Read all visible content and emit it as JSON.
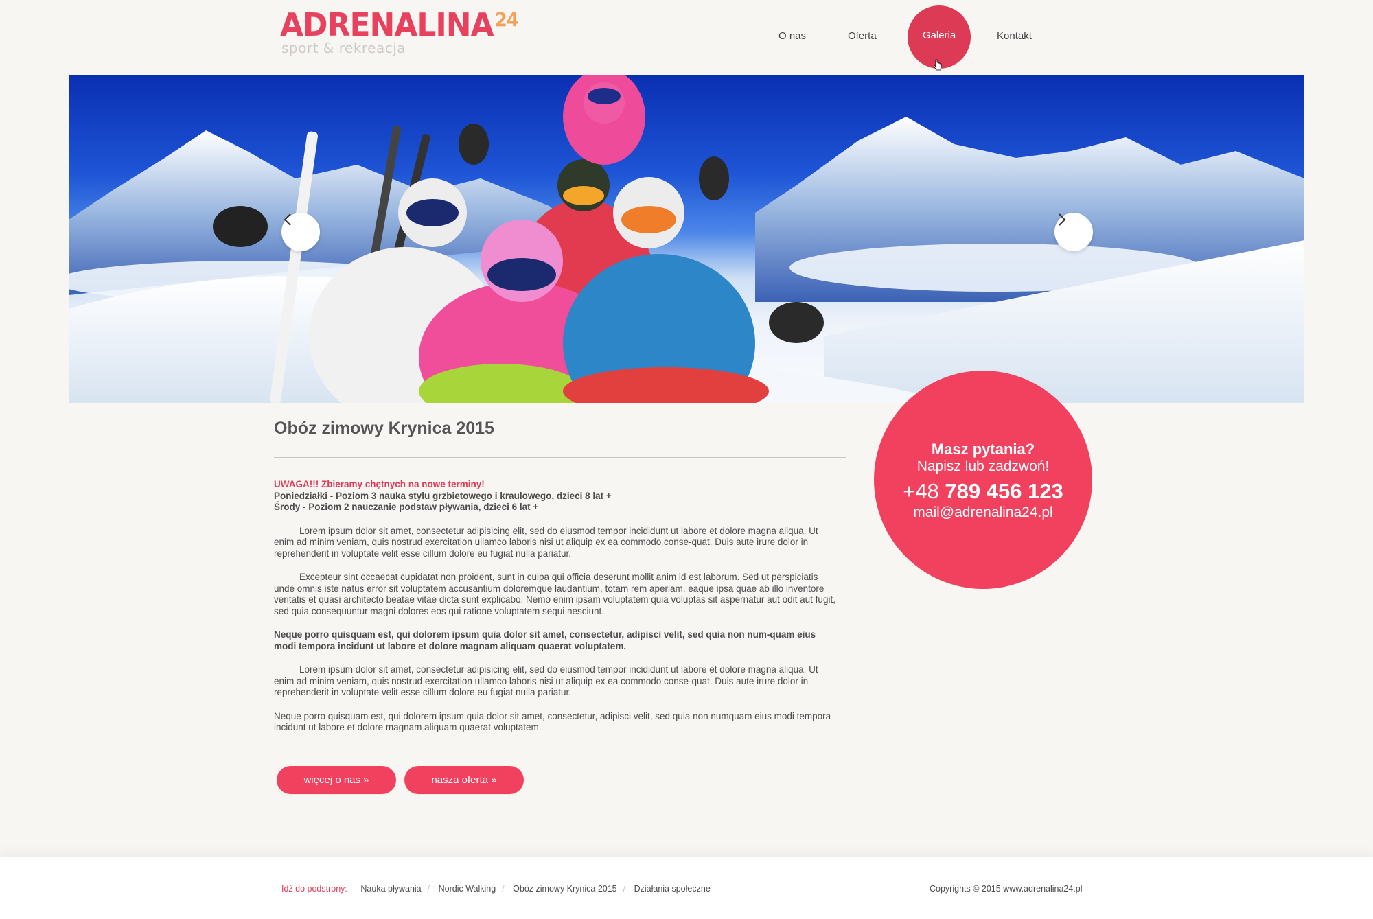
{
  "logo": {
    "main": "ADRENALINA",
    "num": "24",
    "sub": "sport & rekreacja"
  },
  "nav": {
    "items": [
      "O nas",
      "Oferta",
      "Galeria",
      "Kontakt"
    ],
    "active": "Galeria"
  },
  "hero": {
    "prev_icon": "chevron-left-icon",
    "next_icon": "chevron-right-icon"
  },
  "contact": {
    "question": "Masz pytania?",
    "subline": "Napisz lub zadzwoń!",
    "phone_prefix": "+48",
    "phone_number": "789 456 123",
    "email": "mail@adrenalina24.pl"
  },
  "article": {
    "title": "Obóz zimowy Krynica 2015",
    "warning": "UWAGA!!! Zbieramy chętnych na nowe terminy!",
    "line1": "Poniedziałki - Poziom 3 nauka stylu grzbietowego i kraulowego, dzieci 8 lat +",
    "line2": "Środy - Poziom 2 nauczanie podstaw pływania, dzieci 6 lat +",
    "p1": "Lorem ipsum dolor sit amet, consectetur adipisicing elit, sed do eiusmod tempor incididunt ut labore et dolore magna aliqua. Ut enim ad minim veniam, quis nostrud exercitation ullamco laboris nisi ut aliquip ex ea commodo conse-quat. Duis aute irure dolor in reprehenderit in voluptate velit esse cillum dolore eu fugiat nulla pariatur.",
    "p2": "Excepteur sint occaecat cupidatat non proident, sunt in culpa qui officia deserunt mollit anim id est laborum. Sed ut perspiciatis unde omnis iste natus error sit voluptatem accusantium doloremque laudantium, totam rem aperiam, eaque ipsa quae ab illo inventore veritatis et quasi architecto beatae vitae dicta sunt explicabo. Nemo enim ipsam voluptatem quia voluptas sit aspernatur aut odit aut fugit, sed quia consequuntur magni dolores eos qui ratione voluptatem sequi nesciunt.",
    "p3": "Neque porro quisquam est, qui dolorem ipsum quia dolor sit amet, consectetur, adipisci velit, sed quia non num-quam eius modi tempora incidunt ut labore et dolore magnam aliquam quaerat voluptatem.",
    "p4": "Lorem ipsum dolor sit amet, consectetur adipisicing elit, sed do eiusmod tempor incididunt ut labore et dolore magna aliqua. Ut enim ad minim veniam, quis nostrud exercitation ullamco laboris nisi ut aliquip ex ea commodo conse-quat. Duis aute irure dolor in reprehenderit in voluptate velit esse cillum dolore eu fugiat nulla pariatur.",
    "p5": "Neque porro quisquam est, qui dolorem ipsum quia dolor sit amet, consectetur, adipisci velit, sed quia non numquam eius modi tempora incidunt ut labore et dolore magnam aliquam quaerat voluptatem."
  },
  "buttons": {
    "more_about": "więcej o nas  »",
    "offer": "nasza oferta  »"
  },
  "footer": {
    "label": "Idź do podstrony:",
    "links": [
      "Nauka pływania",
      "Nordic Walking",
      "Obóz zimowy Krynica 2015",
      "Działania społeczne"
    ],
    "copyright": "Copyrights © 2015 www.adrenalina24.pl"
  },
  "colors": {
    "accent": "#f2415e",
    "nav_active": "#dc3a55",
    "background": "#f8f6f3"
  }
}
